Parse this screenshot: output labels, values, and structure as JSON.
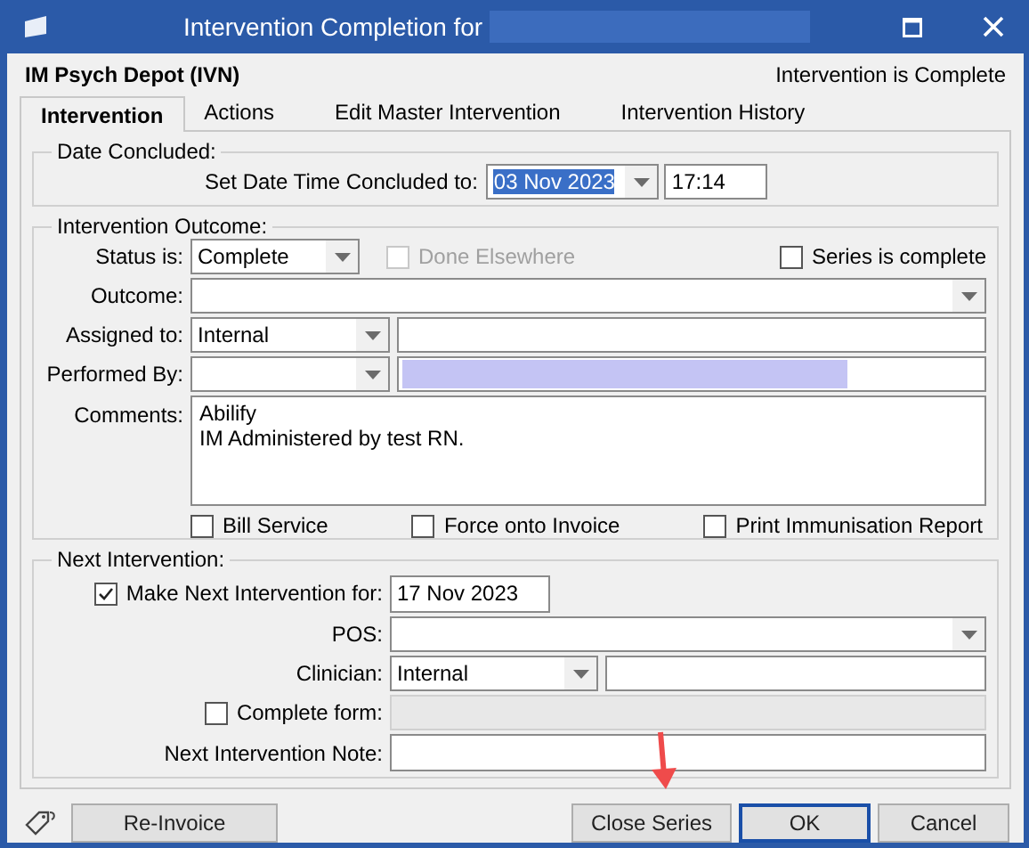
{
  "window": {
    "title": "Intervention Completion for"
  },
  "header": {
    "name": "IM Psych Depot (IVN)",
    "status": "Intervention is Complete"
  },
  "tabs": [
    {
      "label": "Intervention",
      "selected": true
    },
    {
      "label": "Actions",
      "selected": false
    },
    {
      "label": "Edit Master Intervention",
      "selected": false
    },
    {
      "label": "Intervention History",
      "selected": false
    }
  ],
  "date_concluded": {
    "title": "Date Concluded:",
    "label": "Set Date Time Concluded to:",
    "date": "03 Nov 2023",
    "date_highlighted": true,
    "time": "17:14"
  },
  "outcome": {
    "title": "Intervention Outcome:",
    "status_label": "Status is:",
    "status": "Complete",
    "done_elsewhere": {
      "label": "Done Elsewhere",
      "checked": false,
      "disabled": true
    },
    "series_complete": {
      "label": "Series is complete",
      "checked": false
    },
    "outcome_label": "Outcome:",
    "assigned_label": "Assigned to:",
    "assigned": "Internal",
    "performed_label": "Performed By:",
    "comments_label": "Comments:",
    "comments": [
      "Abilify",
      "IM Administered by test RN."
    ],
    "options": [
      {
        "label": "Bill Service",
        "checked": false
      },
      {
        "label": "Force onto Invoice",
        "checked": false
      },
      {
        "label": "Print Immunisation Report",
        "checked": false
      }
    ]
  },
  "next": {
    "title": "Next Intervention:",
    "make_next": {
      "label": "Make Next Intervention for:",
      "checked": true
    },
    "date": "17 Nov 2023",
    "pos_label": "POS:",
    "clinician_label": "Clinician:",
    "clinician": "Internal",
    "complete_form": {
      "label": "Complete form:",
      "checked": false
    },
    "note_label": "Next Intervention Note:"
  },
  "buttons": [
    {
      "label": "Re-Invoice",
      "default": false
    },
    {
      "label": "Close Series",
      "default": false
    },
    {
      "label": "OK",
      "default": true
    },
    {
      "label": "Cancel",
      "default": false
    }
  ]
}
